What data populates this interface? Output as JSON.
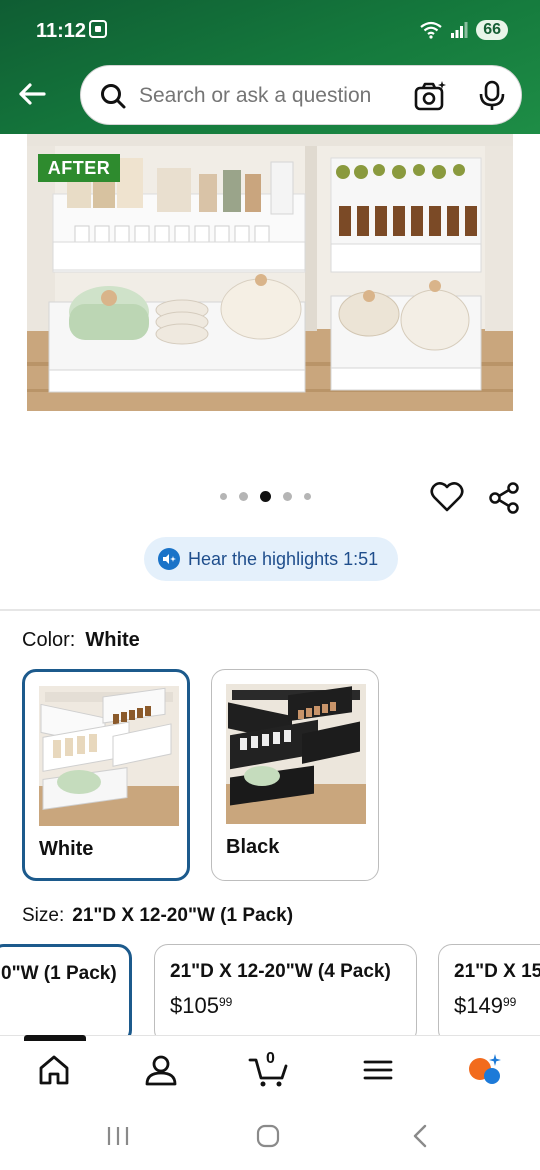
{
  "status_bar": {
    "time": "11:12",
    "battery": "66"
  },
  "search": {
    "placeholder": "Search or ask a question"
  },
  "product_image": {
    "badge": "AFTER"
  },
  "carousel": {
    "dots": 5,
    "active_index": 2
  },
  "highlights": {
    "label": "Hear the highlights 1:51"
  },
  "color": {
    "label": "Color:",
    "selected": "White",
    "options": [
      {
        "label": "White"
      },
      {
        "label": "Black"
      }
    ]
  },
  "size": {
    "label": "Size:",
    "selected": "21\"D X 12-20\"W (1 Pack)",
    "options": [
      {
        "label": "0\"W (1 Pack)"
      },
      {
        "label": "21\"D X 12-20\"W (4 Pack)",
        "price_dollars": "$105",
        "price_cents": "99"
      },
      {
        "label": "21\"D X 15",
        "price_dollars": "$149",
        "price_cents": "99"
      }
    ]
  },
  "nav": {
    "cart_count": "0"
  },
  "colors": {
    "header_green": "#157a3d",
    "accent_blue": "#1c5a8c",
    "spark_orange": "#f26b1d"
  }
}
